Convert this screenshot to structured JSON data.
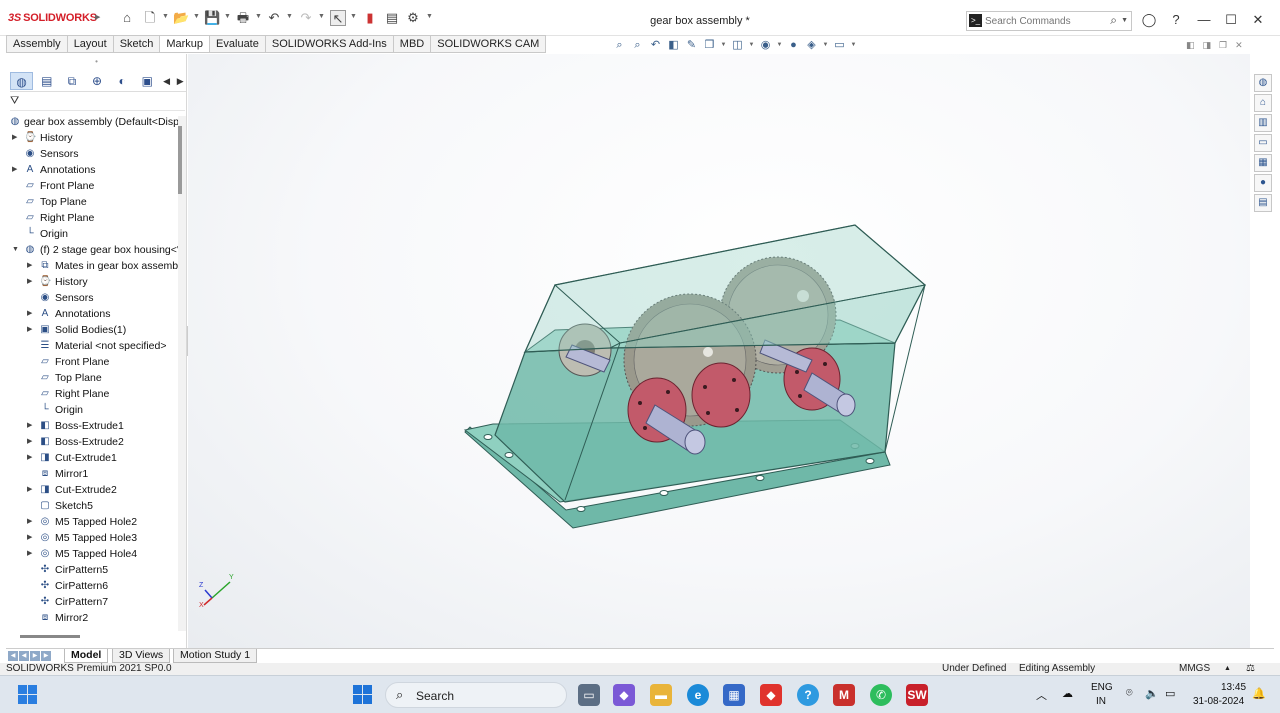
{
  "app": {
    "brand": "SOLIDWORKS",
    "document_title": "gear box assembly *"
  },
  "search": {
    "placeholder": "Search Commands"
  },
  "command_tabs": [
    "Assembly",
    "Layout",
    "Sketch",
    "Markup",
    "Evaluate",
    "SOLIDWORKS Add-Ins",
    "MBD",
    "SOLIDWORKS CAM"
  ],
  "feature_tree": {
    "root": "gear box assembly  (Default<Disp",
    "items": [
      {
        "label": "History",
        "icon": "history-icon",
        "expandable": true,
        "indent": 0
      },
      {
        "label": "Sensors",
        "icon": "sensors-icon",
        "expandable": false,
        "indent": 0
      },
      {
        "label": "Annotations",
        "icon": "annotations-icon",
        "expandable": true,
        "indent": 0
      },
      {
        "label": "Front Plane",
        "icon": "plane-icon",
        "expandable": false,
        "indent": 0
      },
      {
        "label": "Top Plane",
        "icon": "plane-icon",
        "expandable": false,
        "indent": 0
      },
      {
        "label": "Right Plane",
        "icon": "plane-icon",
        "expandable": false,
        "indent": 0
      },
      {
        "label": "Origin",
        "icon": "origin-icon",
        "expandable": false,
        "indent": 0
      },
      {
        "label": "(f) 2 stage gear box housing<'",
        "icon": "part-icon",
        "expandable": true,
        "expanded": true,
        "indent": 0
      },
      {
        "label": "Mates in gear box assembl",
        "icon": "mates-icon",
        "expandable": true,
        "indent": 1
      },
      {
        "label": "History",
        "icon": "history-icon",
        "expandable": true,
        "indent": 1
      },
      {
        "label": "Sensors",
        "icon": "sensors-icon",
        "expandable": false,
        "indent": 1
      },
      {
        "label": "Annotations",
        "icon": "annotations-icon",
        "expandable": true,
        "indent": 1
      },
      {
        "label": "Solid Bodies(1)",
        "icon": "solid-bodies-icon",
        "expandable": true,
        "indent": 1
      },
      {
        "label": "Material <not specified>",
        "icon": "material-icon",
        "expandable": false,
        "indent": 1
      },
      {
        "label": "Front Plane",
        "icon": "plane-icon",
        "expandable": false,
        "indent": 1
      },
      {
        "label": "Top Plane",
        "icon": "plane-icon",
        "expandable": false,
        "indent": 1
      },
      {
        "label": "Right Plane",
        "icon": "plane-icon",
        "expandable": false,
        "indent": 1
      },
      {
        "label": "Origin",
        "icon": "origin-icon",
        "expandable": false,
        "indent": 1
      },
      {
        "label": "Boss-Extrude1",
        "icon": "extrude-icon",
        "expandable": true,
        "indent": 1
      },
      {
        "label": "Boss-Extrude2",
        "icon": "extrude-icon",
        "expandable": true,
        "indent": 1
      },
      {
        "label": "Cut-Extrude1",
        "icon": "cut-extrude-icon",
        "expandable": true,
        "indent": 1
      },
      {
        "label": "Mirror1",
        "icon": "mirror-icon",
        "expandable": false,
        "indent": 1
      },
      {
        "label": "Cut-Extrude2",
        "icon": "cut-extrude-icon",
        "expandable": true,
        "indent": 1
      },
      {
        "label": "Sketch5",
        "icon": "sketch-icon",
        "expandable": false,
        "indent": 1
      },
      {
        "label": "M5 Tapped Hole2",
        "icon": "hole-icon",
        "expandable": true,
        "indent": 1
      },
      {
        "label": "M5 Tapped Hole3",
        "icon": "hole-icon",
        "expandable": true,
        "indent": 1
      },
      {
        "label": "M5 Tapped Hole4",
        "icon": "hole-icon",
        "expandable": true,
        "indent": 1
      },
      {
        "label": "CirPattern5",
        "icon": "pattern-icon",
        "expandable": false,
        "indent": 1
      },
      {
        "label": "CirPattern6",
        "icon": "pattern-icon",
        "expandable": false,
        "indent": 1
      },
      {
        "label": "CirPattern7",
        "icon": "pattern-icon",
        "expandable": false,
        "indent": 1
      },
      {
        "label": "Mirror2",
        "icon": "mirror-icon",
        "expandable": false,
        "indent": 1
      }
    ]
  },
  "bottom_tabs": [
    "Model",
    "3D Views",
    "Motion Study 1"
  ],
  "status": {
    "version": "SOLIDWORKS Premium 2021 SP0.0",
    "definition": "Under Defined",
    "mode": "Editing Assembly",
    "units": "MMGS"
  },
  "taskbar": {
    "search_label": "Search",
    "language_line1": "ENG",
    "language_line2": "IN",
    "time": "13:45",
    "date": "31-08-2024"
  },
  "colors": {
    "housing": "#7fc4b4",
    "flange": "#c25a6a",
    "gear": "#9a9a8e",
    "shaft": "#aab0cc",
    "accent": "#d41f29"
  }
}
